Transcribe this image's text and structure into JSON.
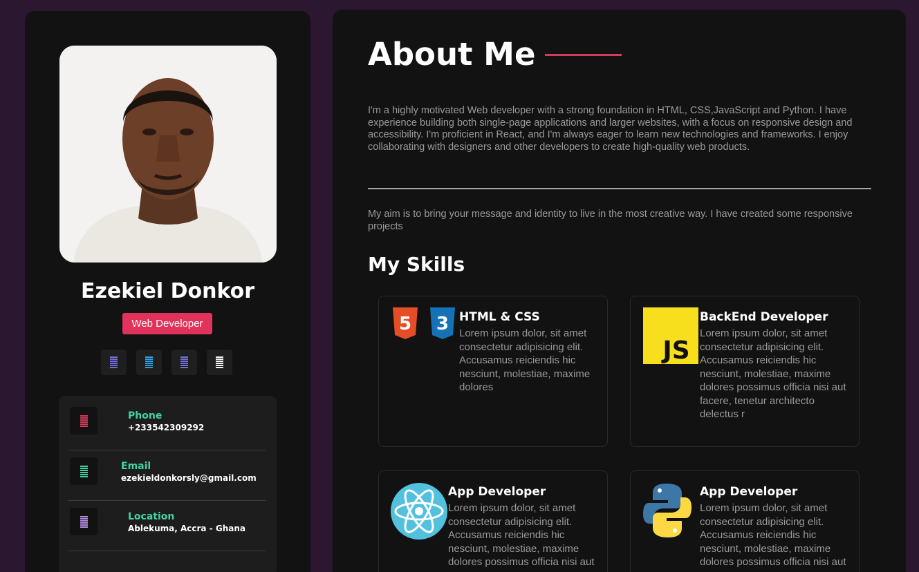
{
  "profile": {
    "name": "Ezekiel Donkor",
    "role": "Web Developer",
    "photo_alt": "",
    "socials": [
      {
        "icon": "github-icon",
        "color": "#6f6fd8"
      },
      {
        "icon": "linkedin-icon",
        "color": "#2aa3e6"
      },
      {
        "icon": "discord-icon",
        "color": "#6f6fd8"
      },
      {
        "icon": "twitter-icon",
        "color": "#f2f2f2"
      }
    ],
    "contacts": [
      {
        "label": "Phone",
        "value": "+233542309292",
        "icon": "phone-icon",
        "color": "#d23c5b"
      },
      {
        "label": "Email",
        "value": "ezekieldonkorsly@gmail.com",
        "icon": "email-icon",
        "color": "#3fd4a3"
      },
      {
        "label": "Location",
        "value": "Ablekuma, Accra - Ghana",
        "icon": "location-icon",
        "color": "#b08ee0"
      }
    ]
  },
  "about": {
    "title": "About Me",
    "intro": "I'm a highly motivated Web developer with a strong foundation in HTML, CSS,JavaScript and Python. I have experience building both single-page applications and larger websites, with a focus on responsive design and accessibility. I'm proficient in React, and I'm always eager to learn new technologies and frameworks. I enjoy collaborating with designers and other developers to create high-quality web products.",
    "aim": "My aim is to bring your message and identity to live in the most creative way. I have created some responsive projects"
  },
  "skills": {
    "title": "My Skills",
    "cards": [
      {
        "title": "HTML & CSS",
        "text": "Lorem ipsum dolor, sit amet consectetur adipisicing elit. Accusamus reiciendis hic nesciunt, molestiae, maxime dolores",
        "icon": "html-css-icon"
      },
      {
        "title": "BackEnd Developer",
        "text": "Lorem ipsum dolor, sit amet consectetur adipisicing elit. Accusamus reiciendis hic nesciunt, molestiae, maxime dolores possimus officia nisi aut facere, tenetur architecto delectus r",
        "icon": "javascript-icon",
        "icon_text": "JS"
      },
      {
        "title": "App Developer",
        "text": "Lorem ipsum dolor, sit amet consectetur adipisicing elit. Accusamus reiciendis hic nesciunt, molestiae, maxime dolores possimus officia nisi aut",
        "icon": "react-icon"
      },
      {
        "title": "App Developer",
        "text": "Lorem ipsum dolor, sit amet consectetur adipisicing elit. Accusamus reiciendis hic nesciunt, molestiae, maxime dolores possimus officia nisi aut",
        "icon": "python-icon"
      }
    ]
  },
  "colors": {
    "background": "#2b1730",
    "panel": "#121212",
    "accent": "#e0325a",
    "label": "#3fd4a3"
  }
}
